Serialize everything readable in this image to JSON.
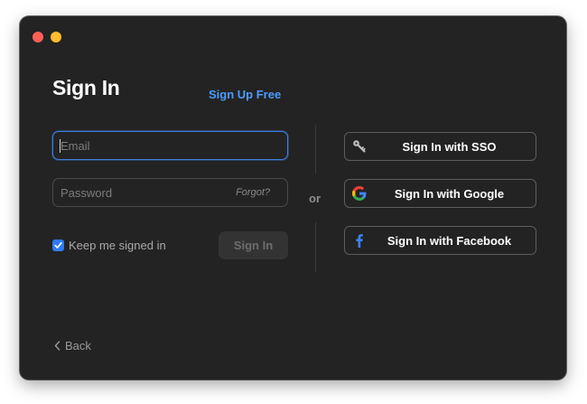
{
  "window": {
    "title": "Sign In",
    "signup_label": "Sign Up Free"
  },
  "form": {
    "email": {
      "placeholder": "Email",
      "value": ""
    },
    "password": {
      "placeholder": "Password",
      "value": "",
      "forgot_label": "Forgot?"
    },
    "keep_signed_in": {
      "label": "Keep me signed in",
      "checked": true
    },
    "submit_label": "Sign In"
  },
  "separator": {
    "or_label": "or"
  },
  "social": {
    "sso": {
      "label": "Sign In with SSO",
      "icon": "key-icon"
    },
    "google": {
      "label": "Sign In with Google",
      "icon": "google-icon"
    },
    "facebook": {
      "label": "Sign In with Facebook",
      "icon": "facebook-icon"
    }
  },
  "footer": {
    "back_label": "Back"
  },
  "colors": {
    "background": "#232323",
    "accent": "#4a9dff",
    "focus_border": "#3d7fe0",
    "checkbox": "#2f7bf5",
    "close": "#fe5f57",
    "minimize": "#febc2e",
    "facebook": "#3b82f6"
  }
}
